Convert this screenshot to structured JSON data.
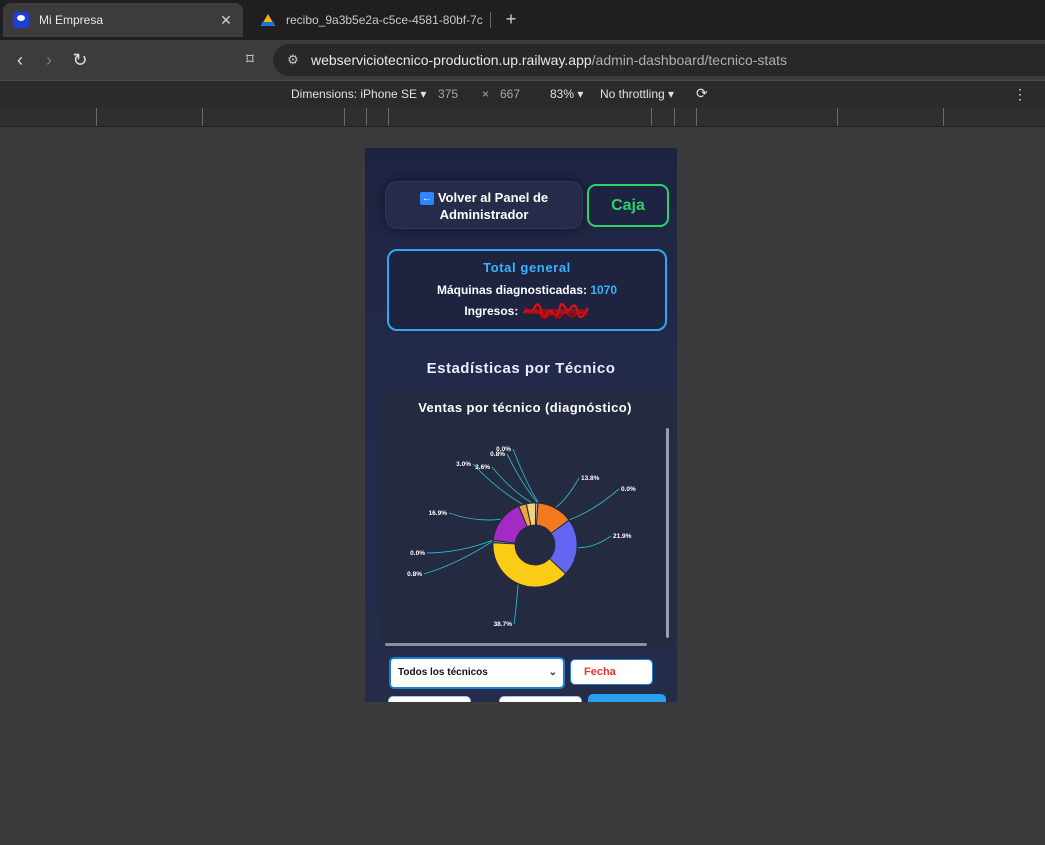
{
  "browser": {
    "tabs": [
      {
        "title": "Mi Empresa",
        "active": true,
        "icon": "app-logo-icon"
      },
      {
        "title": "recibo_9a3b5e2a-c5ce-4581-80bf-7c",
        "active": false,
        "icon": "google-drive-icon"
      }
    ],
    "url_host": "webserviciotecnico-production.up.railway.app",
    "url_path": "/admin-dashboard/tecnico-stats"
  },
  "devtools": {
    "dimensions_label": "Dimensions: iPhone SE",
    "width": "375",
    "times": "×",
    "height": "667",
    "zoom": "83%",
    "throttling": "No throttling"
  },
  "page": {
    "back_label": "Volver al Panel de Administrador",
    "back_arrow": "←",
    "caja_label": "Caja",
    "total": {
      "title": "Total general",
      "machines_label": "Máquinas diagnosticadas:",
      "machines_value": "1070",
      "income_label": "Ingresos:"
    },
    "section_title": "Estadísticas por Técnico",
    "filters": {
      "technician_selected": "Todos los técnicos",
      "date_label": "Fecha"
    }
  },
  "chart_data": {
    "type": "pie",
    "title": "Ventas por técnico (diagnóstico)",
    "donut": true,
    "slices": [
      {
        "label": "13.8%",
        "value": 13.8,
        "color": "#f47a1f"
      },
      {
        "label": "0.0%",
        "value": 0.0,
        "color": "#2dc7c0"
      },
      {
        "label": "21.9%",
        "value": 21.9,
        "color": "#6366f1"
      },
      {
        "label": "38.7%",
        "value": 38.7,
        "color": "#facc15"
      },
      {
        "label": "0.8%",
        "value": 0.8,
        "color": "#8fa7c7"
      },
      {
        "label": "0.0%",
        "value": 0.0,
        "color": "#3b82f6"
      },
      {
        "label": "16.9%",
        "value": 16.9,
        "color": "#a32bc4"
      },
      {
        "label": "3.0%",
        "value": 3.0,
        "color": "#f0a43a"
      },
      {
        "label": "3.6%",
        "value": 3.6,
        "color": "#f4d27a"
      },
      {
        "label": "0.8%",
        "value": 0.8,
        "color": "#e6e6ef"
      },
      {
        "label": "0.0%",
        "value": 0.0,
        "color": "#9fb7d9"
      }
    ]
  }
}
